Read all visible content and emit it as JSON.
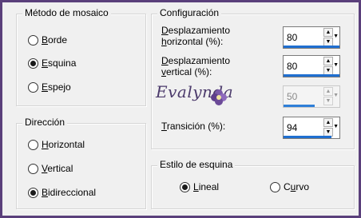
{
  "mosaic_method": {
    "title": "Método de mosaico",
    "options": [
      {
        "pre": "",
        "key": "B",
        "post": "orde",
        "checked": false
      },
      {
        "pre": "",
        "key": "E",
        "post": "squina",
        "checked": true
      },
      {
        "pre": "",
        "key": "E",
        "post": "spejo",
        "checked": false
      }
    ]
  },
  "direction": {
    "title": "Dirección",
    "options": [
      {
        "pre": "",
        "key": "H",
        "post": "orizontal",
        "checked": false
      },
      {
        "pre": "",
        "key": "V",
        "post": "ertical",
        "checked": false
      },
      {
        "pre": "",
        "key": "B",
        "post": "idireccional",
        "checked": true
      }
    ]
  },
  "config": {
    "title": "Configuración",
    "fields": [
      {
        "label_line1_key": "D",
        "label_line1_rest": "esplazamiento",
        "label_line2_pre": "",
        "label_line2_key": "h",
        "label_line2_rest": "orizontal (%):",
        "value": "80",
        "fill": 1.0,
        "enabled": true
      },
      {
        "label_line1_key": "D",
        "label_line1_rest": "esplazamiento",
        "label_line2_pre": "",
        "label_line2_key": "v",
        "label_line2_rest": "ertical (%):",
        "value": "80",
        "fill": 1.0,
        "enabled": true
      },
      {
        "label_line1_key": "",
        "label_line1_rest": "",
        "label_line2_pre": "",
        "label_line2_key": "",
        "label_line2_rest": "",
        "value": "50",
        "fill": 0.55,
        "enabled": false
      },
      {
        "label_line1_key": "T",
        "label_line1_rest": "ransición (%):",
        "label_line2_pre": "",
        "label_line2_key": "",
        "label_line2_rest": "",
        "value": "94",
        "fill": 0.85,
        "enabled": true
      }
    ]
  },
  "corner_style": {
    "title": "Estilo de esquina",
    "options": [
      {
        "pre": "",
        "key": "L",
        "post": "ineal",
        "checked": true
      },
      {
        "pre": "C",
        "key": "u",
        "post": "rvo",
        "checked": false
      }
    ]
  },
  "watermark": "Evalynda",
  "icons": {
    "arrow_up": "▲",
    "arrow_down": "▼",
    "dropdown": "▼"
  }
}
